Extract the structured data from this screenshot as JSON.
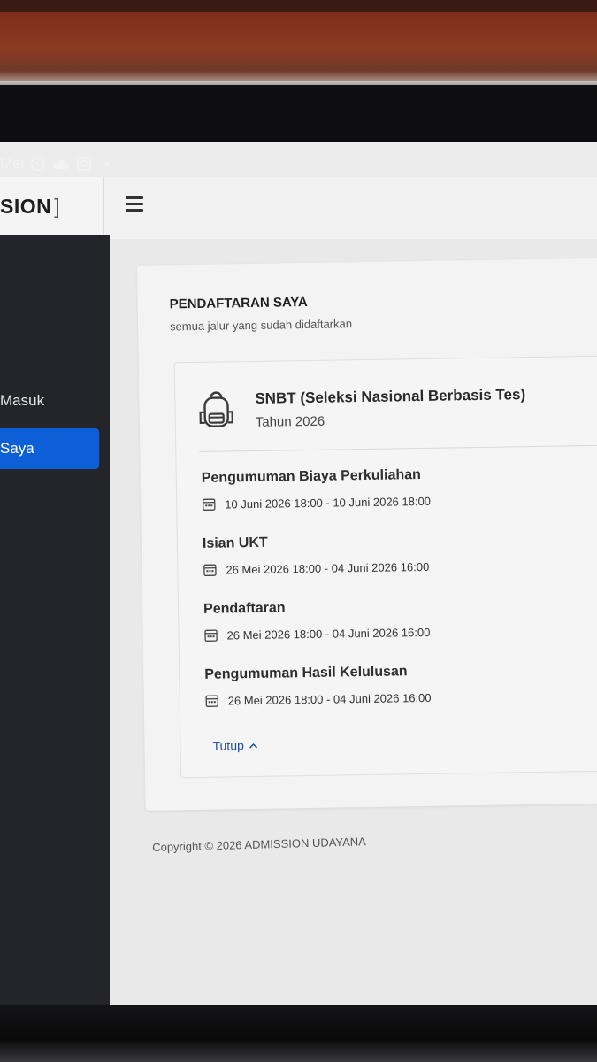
{
  "status_bar": {
    "text": "Mei",
    "icons": [
      "whatsapp-icon",
      "cloud-icon",
      "instagram-icon",
      "dot-icon"
    ]
  },
  "brand": {
    "text": "SION",
    "bracket": "]"
  },
  "sidebar": {
    "items": [
      {
        "label": "Masuk",
        "active": false
      },
      {
        "label": "Saya",
        "active": true
      }
    ]
  },
  "card": {
    "title": "PENDAFTARAN SAYA",
    "subtitle": "semua jalur yang sudah didaftarkan",
    "path": {
      "icon": "backpack-icon",
      "name": "SNBT (Seleksi Nasional Berbasis Tes)",
      "year": "Tahun 2026"
    },
    "events": [
      {
        "name": "Pengumuman Biaya Perkuliahan",
        "date": "10 Juni 2026 18:00 - 10 Juni 2026 18:00"
      },
      {
        "name": "Isian UKT",
        "date": "26 Mei 2026 18:00 - 04 Juni 2026 16:00"
      },
      {
        "name": "Pendaftaran",
        "date": "26 Mei 2026 18:00 - 04 Juni 2026 16:00"
      },
      {
        "name": "Pengumuman Hasil Kelulusan",
        "date": "26 Mei 2026 18:00 - 04 Juni 2026 16:00"
      }
    ],
    "toggle_label": "Tutup"
  },
  "footer": {
    "copyright": "Copyright © 2026 ADMISSION UDAYANA"
  },
  "colors": {
    "accent": "#0d5fd8",
    "sidebar_bg": "#23252a",
    "link": "#1b4f9c"
  }
}
